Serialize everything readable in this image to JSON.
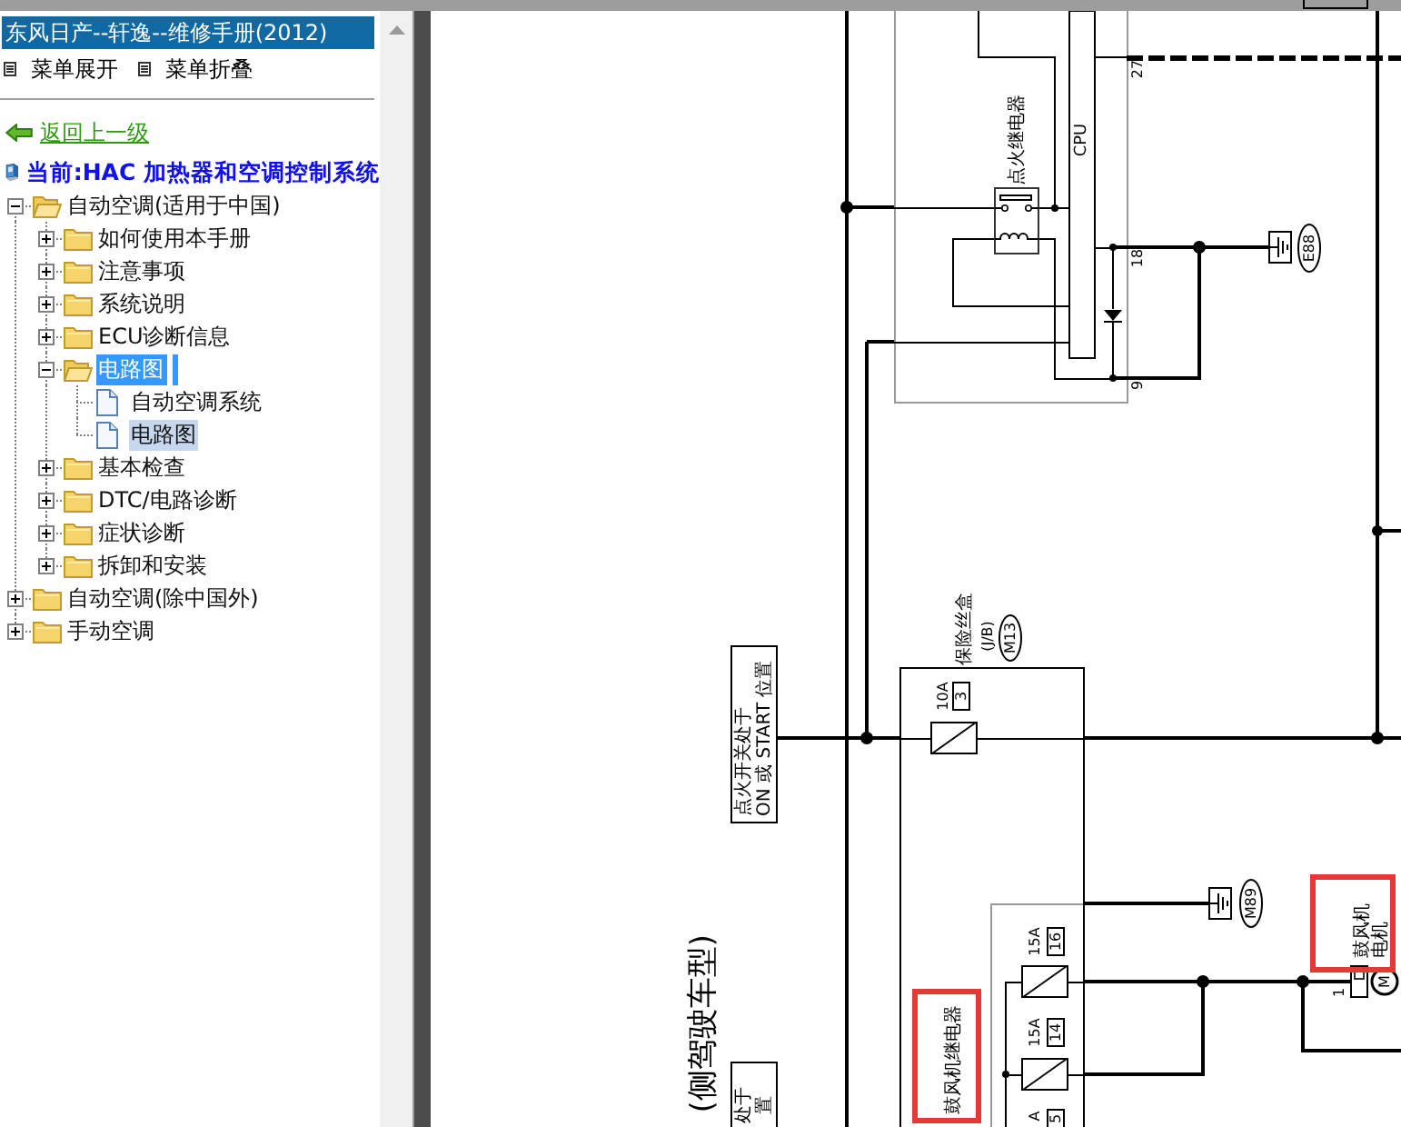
{
  "window": {
    "title": "东风日产--轩逸--维修手册(2012)"
  },
  "menu_actions": [
    "菜单展开",
    "菜单折叠"
  ],
  "back_link": {
    "label": "返回上一级"
  },
  "current_page": {
    "label": "当前:HAC 加热器和空调控制系统"
  },
  "tree": [
    {
      "label": "自动空调(适用于中国)",
      "kind": "folder",
      "expanded": true,
      "selected": false,
      "current": false,
      "children": [
        {
          "label": "如何使用本手册",
          "kind": "folder",
          "expanded": false,
          "selected": false,
          "current": false
        },
        {
          "label": "注意事项",
          "kind": "folder",
          "expanded": false,
          "selected": false,
          "current": false
        },
        {
          "label": "系统说明",
          "kind": "folder",
          "expanded": false,
          "selected": false,
          "current": false
        },
        {
          "label": "ECU诊断信息",
          "kind": "folder",
          "expanded": false,
          "selected": false,
          "current": false
        },
        {
          "label": "电路图",
          "kind": "folder",
          "expanded": true,
          "selected": true,
          "current": false,
          "children": [
            {
              "label": "自动空调系统",
              "kind": "page",
              "selected": false,
              "current": false
            },
            {
              "label": "电路图",
              "kind": "page",
              "selected": false,
              "current": true
            }
          ]
        },
        {
          "label": "基本检查",
          "kind": "folder",
          "expanded": false,
          "selected": false,
          "current": false
        },
        {
          "label": "DTC/电路诊断",
          "kind": "folder",
          "expanded": false,
          "selected": false,
          "current": false
        },
        {
          "label": "症状诊断",
          "kind": "folder",
          "expanded": false,
          "selected": false,
          "current": false
        },
        {
          "label": "拆卸和安装",
          "kind": "folder",
          "expanded": false,
          "selected": false,
          "current": false
        }
      ]
    },
    {
      "label": "自动空调(除中国外)",
      "kind": "folder",
      "expanded": false,
      "selected": false,
      "current": false
    },
    {
      "label": "手动空调",
      "kind": "folder",
      "expanded": false,
      "selected": false,
      "current": false
    }
  ],
  "diagram": {
    "title": "(侧驾驶车型)",
    "ignition_relay": {
      "label": "点火继电器"
    },
    "cpu": {
      "label": "CPU",
      "pins": [
        "27",
        "18",
        "9"
      ]
    },
    "grounds": [
      {
        "connector": "E88"
      },
      {
        "connector": "M89"
      }
    ],
    "fuse_box": {
      "label": "保险丝盒",
      "code": "(J/B)",
      "connector": "M13"
    },
    "fuses": [
      {
        "rating": "10A",
        "number": "3"
      },
      {
        "rating": "15A",
        "number": "16"
      },
      {
        "rating": "15A",
        "number": "14"
      },
      {
        "rating": "A",
        "number": "5"
      }
    ],
    "switch_notes": [
      {
        "lines": [
          "点火开关处于",
          "ON 或 START 位置"
        ]
      },
      {
        "lines": [
          "处于",
          "置"
        ]
      }
    ],
    "blower_relay": {
      "label": "鼓风机继电器",
      "highlighted": true
    },
    "blower_motor": {
      "lines": [
        "鼓风机",
        "电机"
      ],
      "pin": "1",
      "symbol": "M",
      "highlighted": true
    }
  }
}
